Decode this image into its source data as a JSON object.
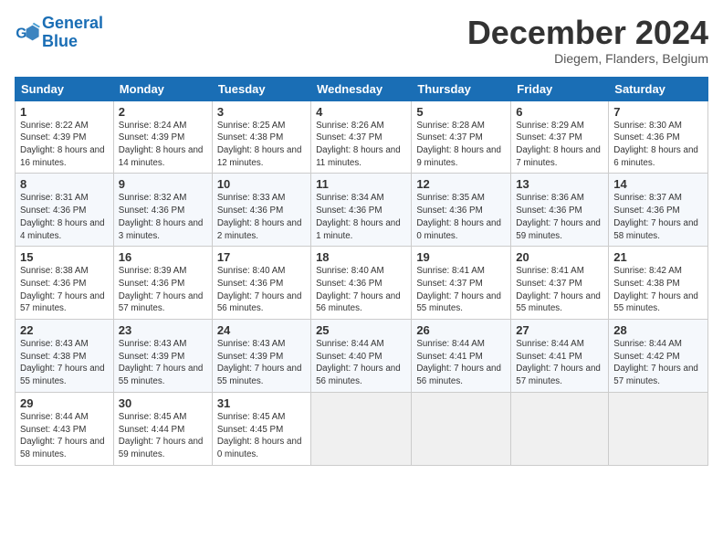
{
  "header": {
    "logo_line1": "General",
    "logo_line2": "Blue",
    "month_title": "December 2024",
    "location": "Diegem, Flanders, Belgium"
  },
  "weekdays": [
    "Sunday",
    "Monday",
    "Tuesday",
    "Wednesday",
    "Thursday",
    "Friday",
    "Saturday"
  ],
  "weeks": [
    [
      {
        "day": "1",
        "sunrise": "Sunrise: 8:22 AM",
        "sunset": "Sunset: 4:39 PM",
        "daylight": "Daylight: 8 hours and 16 minutes."
      },
      {
        "day": "2",
        "sunrise": "Sunrise: 8:24 AM",
        "sunset": "Sunset: 4:39 PM",
        "daylight": "Daylight: 8 hours and 14 minutes."
      },
      {
        "day": "3",
        "sunrise": "Sunrise: 8:25 AM",
        "sunset": "Sunset: 4:38 PM",
        "daylight": "Daylight: 8 hours and 12 minutes."
      },
      {
        "day": "4",
        "sunrise": "Sunrise: 8:26 AM",
        "sunset": "Sunset: 4:37 PM",
        "daylight": "Daylight: 8 hours and 11 minutes."
      },
      {
        "day": "5",
        "sunrise": "Sunrise: 8:28 AM",
        "sunset": "Sunset: 4:37 PM",
        "daylight": "Daylight: 8 hours and 9 minutes."
      },
      {
        "day": "6",
        "sunrise": "Sunrise: 8:29 AM",
        "sunset": "Sunset: 4:37 PM",
        "daylight": "Daylight: 8 hours and 7 minutes."
      },
      {
        "day": "7",
        "sunrise": "Sunrise: 8:30 AM",
        "sunset": "Sunset: 4:36 PM",
        "daylight": "Daylight: 8 hours and 6 minutes."
      }
    ],
    [
      {
        "day": "8",
        "sunrise": "Sunrise: 8:31 AM",
        "sunset": "Sunset: 4:36 PM",
        "daylight": "Daylight: 8 hours and 4 minutes."
      },
      {
        "day": "9",
        "sunrise": "Sunrise: 8:32 AM",
        "sunset": "Sunset: 4:36 PM",
        "daylight": "Daylight: 8 hours and 3 minutes."
      },
      {
        "day": "10",
        "sunrise": "Sunrise: 8:33 AM",
        "sunset": "Sunset: 4:36 PM",
        "daylight": "Daylight: 8 hours and 2 minutes."
      },
      {
        "day": "11",
        "sunrise": "Sunrise: 8:34 AM",
        "sunset": "Sunset: 4:36 PM",
        "daylight": "Daylight: 8 hours and 1 minute."
      },
      {
        "day": "12",
        "sunrise": "Sunrise: 8:35 AM",
        "sunset": "Sunset: 4:36 PM",
        "daylight": "Daylight: 8 hours and 0 minutes."
      },
      {
        "day": "13",
        "sunrise": "Sunrise: 8:36 AM",
        "sunset": "Sunset: 4:36 PM",
        "daylight": "Daylight: 7 hours and 59 minutes."
      },
      {
        "day": "14",
        "sunrise": "Sunrise: 8:37 AM",
        "sunset": "Sunset: 4:36 PM",
        "daylight": "Daylight: 7 hours and 58 minutes."
      }
    ],
    [
      {
        "day": "15",
        "sunrise": "Sunrise: 8:38 AM",
        "sunset": "Sunset: 4:36 PM",
        "daylight": "Daylight: 7 hours and 57 minutes."
      },
      {
        "day": "16",
        "sunrise": "Sunrise: 8:39 AM",
        "sunset": "Sunset: 4:36 PM",
        "daylight": "Daylight: 7 hours and 57 minutes."
      },
      {
        "day": "17",
        "sunrise": "Sunrise: 8:40 AM",
        "sunset": "Sunset: 4:36 PM",
        "daylight": "Daylight: 7 hours and 56 minutes."
      },
      {
        "day": "18",
        "sunrise": "Sunrise: 8:40 AM",
        "sunset": "Sunset: 4:36 PM",
        "daylight": "Daylight: 7 hours and 56 minutes."
      },
      {
        "day": "19",
        "sunrise": "Sunrise: 8:41 AM",
        "sunset": "Sunset: 4:37 PM",
        "daylight": "Daylight: 7 hours and 55 minutes."
      },
      {
        "day": "20",
        "sunrise": "Sunrise: 8:41 AM",
        "sunset": "Sunset: 4:37 PM",
        "daylight": "Daylight: 7 hours and 55 minutes."
      },
      {
        "day": "21",
        "sunrise": "Sunrise: 8:42 AM",
        "sunset": "Sunset: 4:38 PM",
        "daylight": "Daylight: 7 hours and 55 minutes."
      }
    ],
    [
      {
        "day": "22",
        "sunrise": "Sunrise: 8:43 AM",
        "sunset": "Sunset: 4:38 PM",
        "daylight": "Daylight: 7 hours and 55 minutes."
      },
      {
        "day": "23",
        "sunrise": "Sunrise: 8:43 AM",
        "sunset": "Sunset: 4:39 PM",
        "daylight": "Daylight: 7 hours and 55 minutes."
      },
      {
        "day": "24",
        "sunrise": "Sunrise: 8:43 AM",
        "sunset": "Sunset: 4:39 PM",
        "daylight": "Daylight: 7 hours and 55 minutes."
      },
      {
        "day": "25",
        "sunrise": "Sunrise: 8:44 AM",
        "sunset": "Sunset: 4:40 PM",
        "daylight": "Daylight: 7 hours and 56 minutes."
      },
      {
        "day": "26",
        "sunrise": "Sunrise: 8:44 AM",
        "sunset": "Sunset: 4:41 PM",
        "daylight": "Daylight: 7 hours and 56 minutes."
      },
      {
        "day": "27",
        "sunrise": "Sunrise: 8:44 AM",
        "sunset": "Sunset: 4:41 PM",
        "daylight": "Daylight: 7 hours and 57 minutes."
      },
      {
        "day": "28",
        "sunrise": "Sunrise: 8:44 AM",
        "sunset": "Sunset: 4:42 PM",
        "daylight": "Daylight: 7 hours and 57 minutes."
      }
    ],
    [
      {
        "day": "29",
        "sunrise": "Sunrise: 8:44 AM",
        "sunset": "Sunset: 4:43 PM",
        "daylight": "Daylight: 7 hours and 58 minutes."
      },
      {
        "day": "30",
        "sunrise": "Sunrise: 8:45 AM",
        "sunset": "Sunset: 4:44 PM",
        "daylight": "Daylight: 7 hours and 59 minutes."
      },
      {
        "day": "31",
        "sunrise": "Sunrise: 8:45 AM",
        "sunset": "Sunset: 4:45 PM",
        "daylight": "Daylight: 8 hours and 0 minutes."
      },
      null,
      null,
      null,
      null
    ]
  ]
}
